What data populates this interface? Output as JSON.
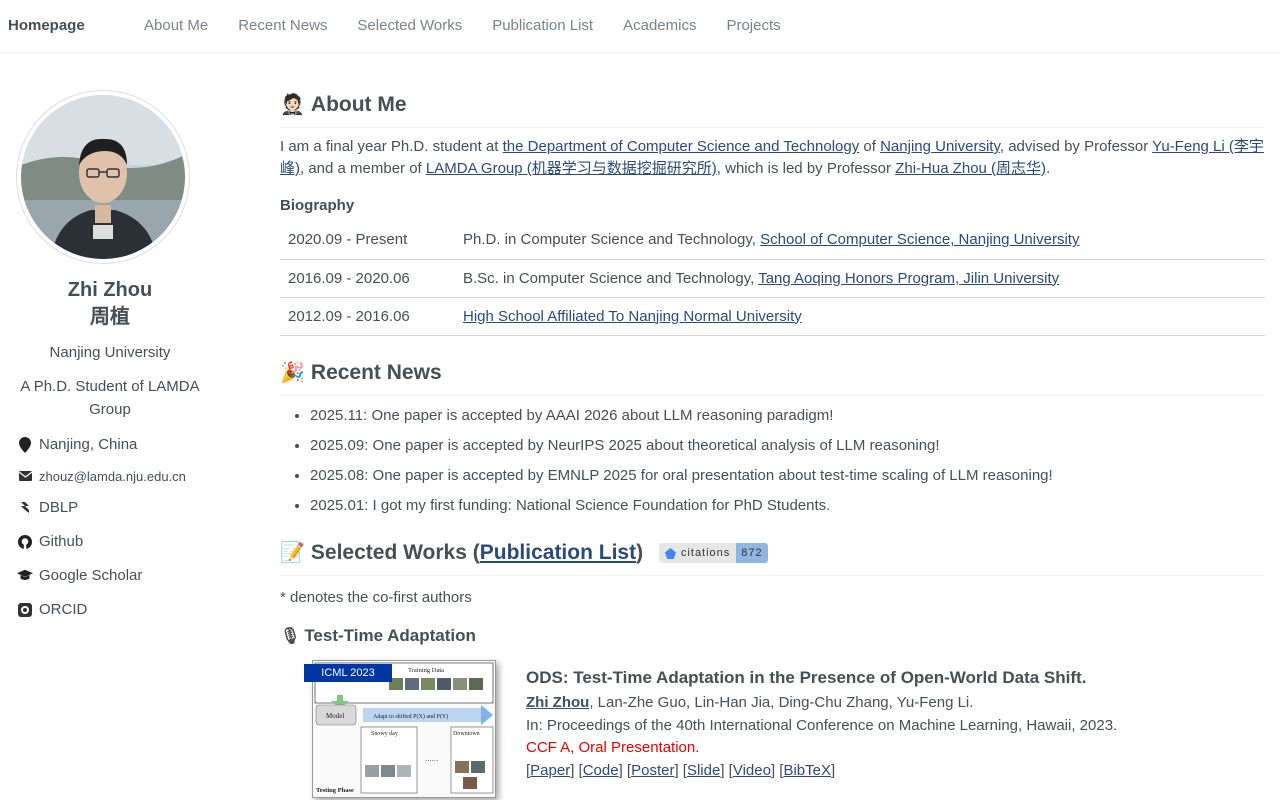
{
  "nav": {
    "brand": "Homepage",
    "links": [
      "About Me",
      "Recent News",
      "Selected Works",
      "Publication List",
      "Academics",
      "Projects"
    ]
  },
  "sidebar": {
    "name": "Zhi Zhou",
    "name_cn": "周植",
    "affiliation": "Nanjing University",
    "bio": "A Ph.D. Student of LAMDA Group",
    "items": [
      {
        "icon": "location-pin-icon",
        "label": "Nanjing, China"
      },
      {
        "icon": "envelope-icon",
        "label": "zhouz@lamda.nju.edu.cn"
      },
      {
        "icon": "dblp-icon",
        "label": "DBLP"
      },
      {
        "icon": "github-icon",
        "label": "Github"
      },
      {
        "icon": "graduation-cap-icon",
        "label": "Google Scholar"
      },
      {
        "icon": "orcid-icon",
        "label": "ORCID"
      }
    ]
  },
  "about": {
    "heading": "About Me",
    "emoji": "🤵🏻",
    "p_prefix": "I am a final year Ph.D. student at ",
    "link_dept": "the Department of Computer Science and Technology",
    "p_of": " of ",
    "link_nju": "Nanjing University",
    "p_advised": ", advised by Professor ",
    "link_advisor": "Yu-Feng Li (李宇峰)",
    "p_member": ", and a member of ",
    "link_lamda": "LAMDA Group (机器学习与数据挖掘研究所)",
    "p_led": ", which is led by Professor ",
    "link_zhou": "Zhi-Hua Zhou (周志华)",
    "p_end": ".",
    "biography_label": "Biography",
    "biography": [
      {
        "date": "2020.09 - Present",
        "text": "Ph.D. in Computer Science and Technology, ",
        "link": "School of Computer Science, Nanjing University"
      },
      {
        "date": "2016.09 - 2020.06",
        "text": "B.Sc. in Computer Science and Technology, ",
        "link": "Tang Aoqing Honors Program, Jilin University"
      },
      {
        "date": "2012.09 - 2016.06",
        "text": "",
        "link": "High School Affiliated To Nanjing Normal University"
      }
    ]
  },
  "news": {
    "heading": "Recent News",
    "emoji": "🎉",
    "items": [
      "2025.11: One paper is accepted by AAAI 2026 about LLM reasoning paradigm!",
      "2025.09: One paper is accepted by NeurIPS 2025 about theoretical analysis of LLM reasoning!",
      "2025.08: One paper is accepted by EMNLP 2025 for oral presentation about test-time scaling of LLM reasoning!",
      "2025.01: I got my first funding: National Science Foundation for PhD Students."
    ]
  },
  "works": {
    "emoji": "📝",
    "heading_prefix": "Selected Works (",
    "heading_link": "Publication List",
    "heading_suffix": ")",
    "badge_label": "citations",
    "badge_count": "872",
    "cofirst_note": "* denotes the co-first authors",
    "sub_emoji": "🎙",
    "sub_heading": "Test-Time Adaptation",
    "paper": {
      "venue_badge": "ICML 2023",
      "title": "ODS: Test-Time Adaptation in the Presence of Open-World Data Shift.",
      "first_author": "Zhi Zhou",
      "other_authors": ", Lan-Zhe Guo, Lin-Han Jia, Ding-Chu Zhang, Yu-Feng Li.",
      "venue": "In: Proceedings of the 40th International Conference on Machine Learning, Hawaii, 2023.",
      "ccf": "CCF A, Oral Presentation.",
      "links": [
        "Paper",
        "Code",
        "Poster",
        "Slide",
        "Video",
        "BibTeX"
      ],
      "thumb": {
        "training_data": "Training Data",
        "model": "Model",
        "adapt": "Adapt to shifted P(X) and P(Y)",
        "snowy": "Snowy day",
        "downtown": "Downtown",
        "testing": "Testing Phase"
      }
    }
  }
}
